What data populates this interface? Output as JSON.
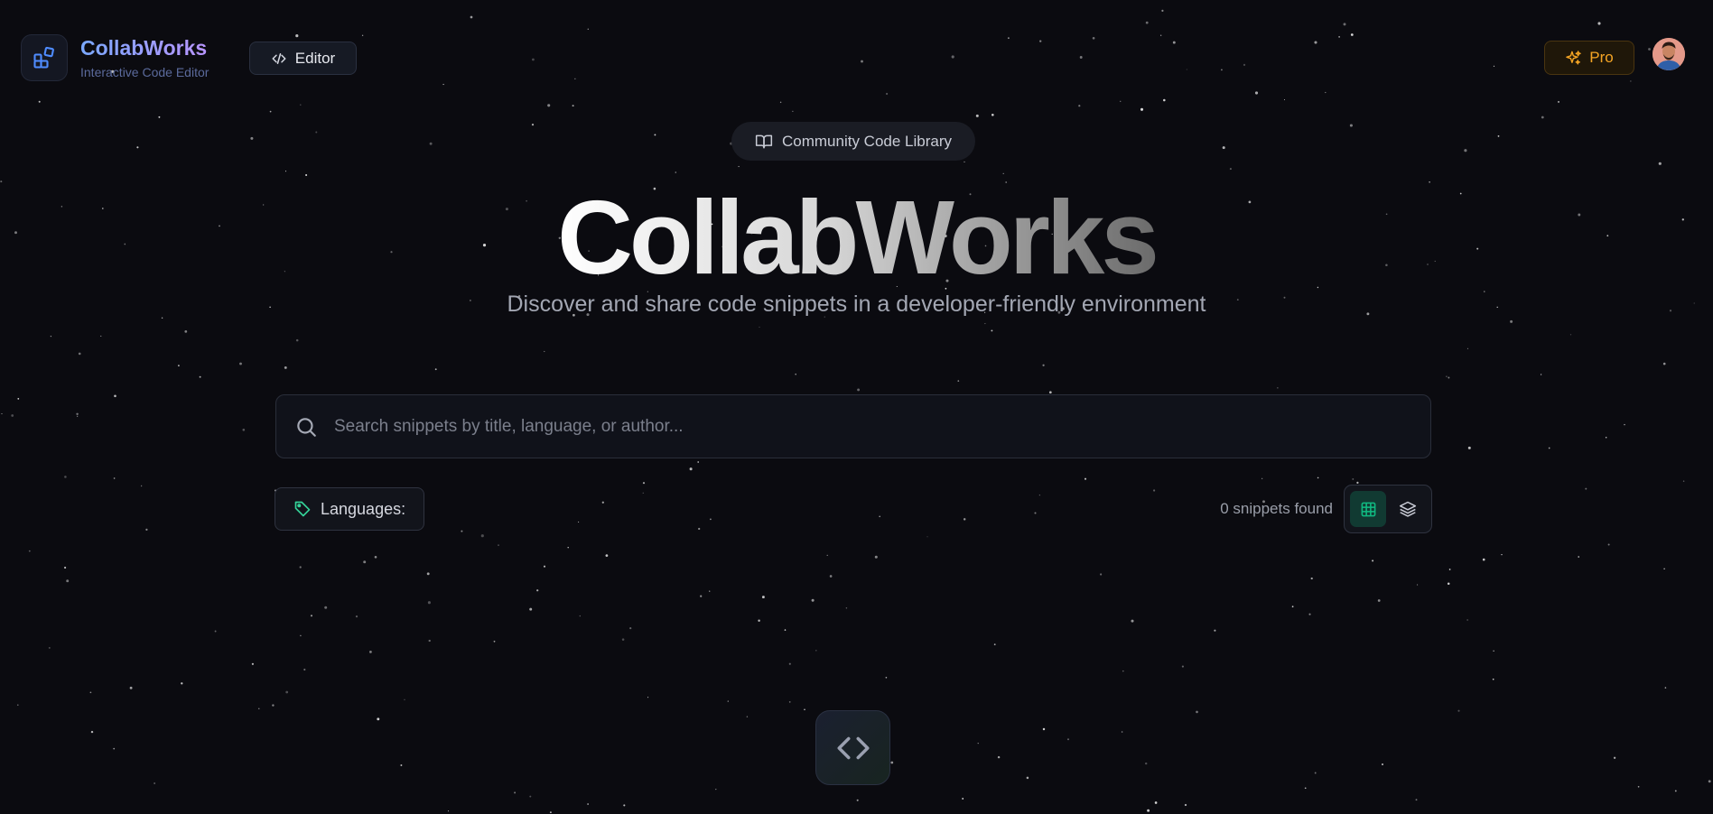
{
  "header": {
    "brand_title": "CollabWorks",
    "brand_subtitle": "Interactive Code Editor",
    "editor_label": "Editor",
    "pro_label": "Pro"
  },
  "hero": {
    "badge_label": "Community Code Library",
    "title": "CollabWorks",
    "subtitle": "Discover and share code snippets in a developer-friendly environment"
  },
  "search": {
    "value": "",
    "placeholder": "Search snippets by title, language, or author..."
  },
  "filters": {
    "languages_label": "Languages:",
    "results_count": "0 snippets found",
    "view_modes": [
      "grid",
      "list"
    ],
    "active_view": "grid"
  },
  "icons": {
    "logo": "grid-blocks-icon",
    "editor": "code-icon",
    "pro": "sparkles-icon",
    "badge": "book-open-icon",
    "search": "search-icon",
    "languages": "tag-icon",
    "grid_view": "grid-icon",
    "list_view": "layers-icon",
    "empty_state": "code-icon"
  },
  "colors": {
    "background": "#0b0b10",
    "brand_gradient_start": "#7aa8ff",
    "brand_gradient_end": "#b895ff",
    "pro_accent": "#f5a524",
    "active_toggle": "#10b981",
    "tag_icon": "#34d399"
  }
}
